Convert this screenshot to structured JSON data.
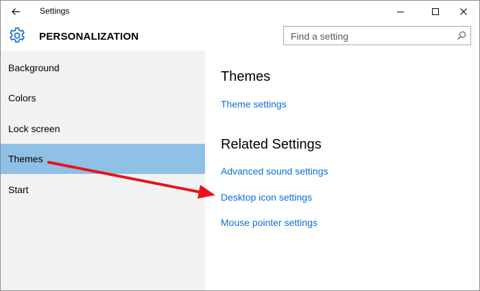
{
  "window": {
    "title": "Settings",
    "controls": {
      "minimize": "minimize",
      "maximize": "maximize",
      "close": "close"
    }
  },
  "header": {
    "icon": "gear-icon",
    "title": "PERSONALIZATION",
    "search": {
      "placeholder": "Find a setting",
      "value": ""
    }
  },
  "sidebar": {
    "items": [
      {
        "label": "Background",
        "selected": false
      },
      {
        "label": "Colors",
        "selected": false
      },
      {
        "label": "Lock screen",
        "selected": false
      },
      {
        "label": "Themes",
        "selected": true
      },
      {
        "label": "Start",
        "selected": false
      }
    ],
    "selected_color": "#8fc0e6"
  },
  "main": {
    "themes_heading": "Themes",
    "theme_settings_link": "Theme settings",
    "related_heading": "Related Settings",
    "related_links": [
      "Advanced sound settings",
      "Desktop icon settings",
      "Mouse pointer settings"
    ],
    "link_color": "#0a6fcf"
  },
  "annotation": {
    "arrow_color": "#e8141a"
  }
}
